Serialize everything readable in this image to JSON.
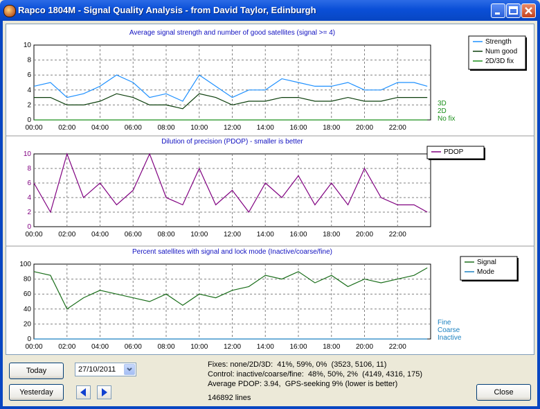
{
  "window": {
    "title": "Rapco 1804M - Signal Quality Analysis - from David Taylor, Edinburgh"
  },
  "colors": {
    "strength": "#1e90ff",
    "numgood": "#0a3d0a",
    "fix": "#1a8f1a",
    "pdop": "#800080",
    "signal": "#1a6e1a",
    "mode": "#1a80c0",
    "title_text": "#1010c0"
  },
  "x_ticks": [
    "00:00",
    "02:00",
    "04:00",
    "06:00",
    "08:00",
    "10:00",
    "12:00",
    "14:00",
    "16:00",
    "18:00",
    "20:00",
    "22:00"
  ],
  "chart_data": [
    {
      "type": "line",
      "title": "Average signal strength and number of good satellites (signal >= 4)",
      "ylim": [
        0,
        10
      ],
      "y_ticks": [
        "0",
        "2",
        "4",
        "6",
        "8",
        "10"
      ],
      "x_range_hours": [
        0,
        24
      ],
      "right_labels": [
        "3D",
        "2D",
        "No fix"
      ],
      "legend": [
        "Strength",
        "Num good",
        "2D/3D fix"
      ],
      "series": [
        {
          "name": "Strength",
          "x": [
            0,
            1,
            2,
            3,
            4,
            5,
            6,
            7,
            8,
            9,
            10,
            11,
            12,
            13,
            14,
            15,
            16,
            17,
            18,
            19,
            20,
            21,
            22,
            23,
            23.8
          ],
          "values": [
            4.5,
            5,
            3,
            3.5,
            4.5,
            6,
            5,
            3,
            3.5,
            2.5,
            6,
            4.5,
            3,
            4,
            4,
            5.5,
            5,
            4.5,
            4.5,
            5,
            4,
            4,
            5,
            5,
            4.5
          ]
        },
        {
          "name": "Num good",
          "x": [
            0,
            1,
            2,
            3,
            4,
            5,
            6,
            7,
            8,
            9,
            10,
            11,
            12,
            13,
            14,
            15,
            16,
            17,
            18,
            19,
            20,
            21,
            22,
            23,
            23.8
          ],
          "values": [
            3,
            3,
            2,
            2,
            2.5,
            3.5,
            3,
            2,
            2,
            1.5,
            3.5,
            3,
            2,
            2.5,
            2.5,
            3,
            3,
            2.5,
            2.5,
            3,
            2.5,
            2.5,
            3,
            3,
            3
          ]
        },
        {
          "name": "2D/3D fix",
          "x": [
            0,
            1,
            2,
            3,
            4,
            5,
            6,
            7,
            8,
            9,
            10,
            11,
            12,
            13,
            14,
            15,
            16,
            17,
            18,
            19,
            20,
            21,
            22,
            23,
            23.8
          ],
          "values": [
            0,
            0,
            0,
            0,
            0,
            0,
            0,
            0,
            0,
            0,
            0,
            0,
            0,
            0,
            0,
            0,
            0,
            0,
            0,
            0,
            0,
            0,
            0,
            0,
            0
          ]
        }
      ]
    },
    {
      "type": "line",
      "title": "Dilution of precision (PDOP) - smaller is better",
      "ylim": [
        0,
        10
      ],
      "y_ticks": [
        "0",
        "2",
        "4",
        "6",
        "8",
        "10"
      ],
      "x_range_hours": [
        0,
        24
      ],
      "legend": [
        "PDOP"
      ],
      "series": [
        {
          "name": "PDOP",
          "x": [
            0,
            1,
            2,
            3,
            4,
            5,
            6,
            7,
            8,
            9,
            10,
            11,
            12,
            13,
            14,
            15,
            16,
            17,
            18,
            19,
            20,
            21,
            22,
            23,
            23.8
          ],
          "values": [
            6,
            2,
            10,
            4,
            6,
            3,
            5,
            10,
            4,
            3,
            8,
            3,
            5,
            2,
            6,
            4,
            7,
            3,
            6,
            3,
            8,
            4,
            3,
            3,
            2
          ]
        }
      ]
    },
    {
      "type": "line",
      "title": "Percent satellites with signal and lock mode (Inactive/coarse/fine)",
      "ylim": [
        0,
        100
      ],
      "y_ticks": [
        "0",
        "20",
        "40",
        "60",
        "80",
        "100"
      ],
      "x_range_hours": [
        0,
        24
      ],
      "right_labels": [
        "Fine",
        "Coarse",
        "Inactive"
      ],
      "legend": [
        "Signal",
        "Mode"
      ],
      "series": [
        {
          "name": "Signal",
          "x": [
            0,
            1,
            2,
            3,
            4,
            5,
            6,
            7,
            8,
            9,
            10,
            11,
            12,
            13,
            14,
            15,
            16,
            17,
            18,
            19,
            20,
            21,
            22,
            23,
            23.8
          ],
          "values": [
            90,
            85,
            40,
            55,
            65,
            60,
            55,
            50,
            60,
            45,
            60,
            55,
            65,
            70,
            85,
            80,
            90,
            75,
            85,
            70,
            80,
            75,
            80,
            85,
            95
          ]
        },
        {
          "name": "Mode",
          "x": [
            0,
            1,
            2,
            3,
            4,
            5,
            6,
            7,
            8,
            9,
            10,
            11,
            12,
            13,
            14,
            15,
            16,
            17,
            18,
            19,
            20,
            21,
            22,
            23,
            23.8
          ],
          "values": [
            0,
            0,
            0,
            0,
            0,
            0,
            0,
            0,
            0,
            0,
            0,
            0,
            0,
            0,
            0,
            0,
            0,
            0,
            0,
            0,
            0,
            0,
            0,
            0,
            0
          ]
        }
      ]
    }
  ],
  "controls": {
    "today": "Today",
    "yesterday": "Yesterday",
    "date": "27/10/2011",
    "close": "Close"
  },
  "stats": {
    "line1": "Fixes: none/2D/3D:  41%, 59%, 0%  (3523, 5106, 11)",
    "line2": "Control: inactive/coarse/fine:  48%, 50%, 2%  (4149, 4316, 175)",
    "line3": "Average PDOP: 3.94,  GPS-seeking 9% (lower is better)",
    "line4": "146892 lines"
  }
}
